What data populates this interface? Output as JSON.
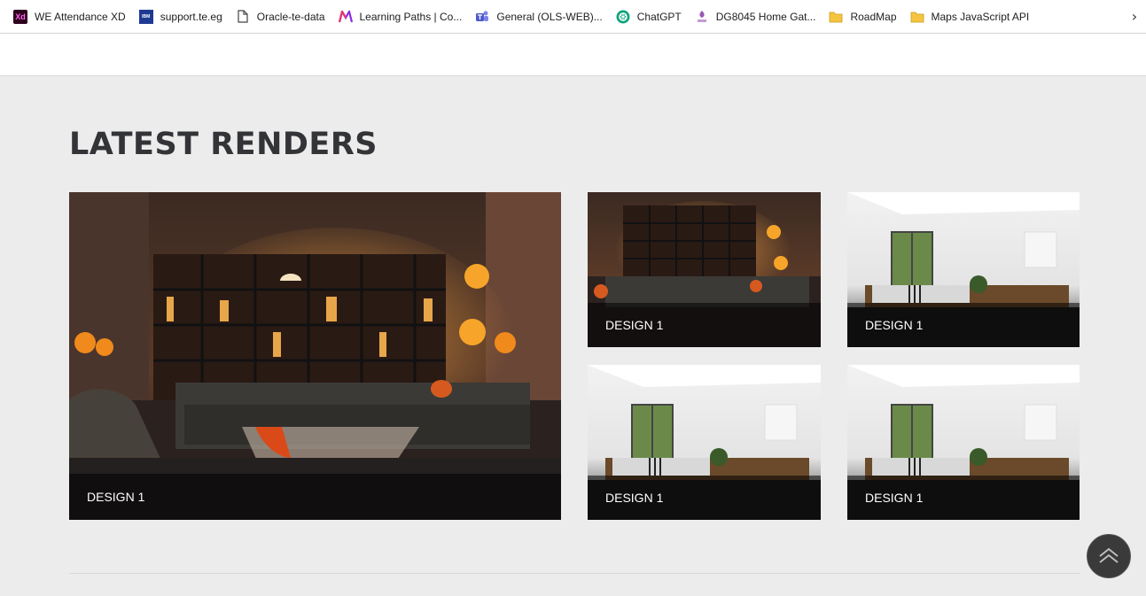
{
  "bookmarks": [
    {
      "label": "WE Attendance XD",
      "icon": "adobe-xd-icon"
    },
    {
      "label": "support.te.eg",
      "icon": "ibm-icon"
    },
    {
      "label": "Oracle-te-data",
      "icon": "page-icon"
    },
    {
      "label": "Learning Paths | Co...",
      "icon": "m-logo-icon"
    },
    {
      "label": "General (OLS-WEB)...",
      "icon": "teams-icon"
    },
    {
      "label": "ChatGPT",
      "icon": "chatgpt-icon"
    },
    {
      "label": "DG8045 Home Gat...",
      "icon": "router-icon"
    },
    {
      "label": "RoadMap",
      "icon": "folder-icon"
    },
    {
      "label": "Maps JavaScript API",
      "icon": "folder-icon"
    }
  ],
  "xd_glyph": "Xd",
  "ibm_glyph": "IBM",
  "more_glyph": "›",
  "section": {
    "title": "LATEST RENDERS"
  },
  "renders": [
    {
      "caption": "DESIGN 1",
      "scene": "halloween-living-room"
    },
    {
      "caption": "DESIGN 1",
      "scene": "halloween-living-room"
    },
    {
      "caption": "DESIGN 1",
      "scene": "white-living-room"
    },
    {
      "caption": "DESIGN 1",
      "scene": "white-living-room"
    },
    {
      "caption": "DESIGN 1",
      "scene": "white-living-room"
    }
  ],
  "colors": {
    "background": "#ececec",
    "title": "#333437",
    "scroll_button": "#3a3a3a"
  }
}
